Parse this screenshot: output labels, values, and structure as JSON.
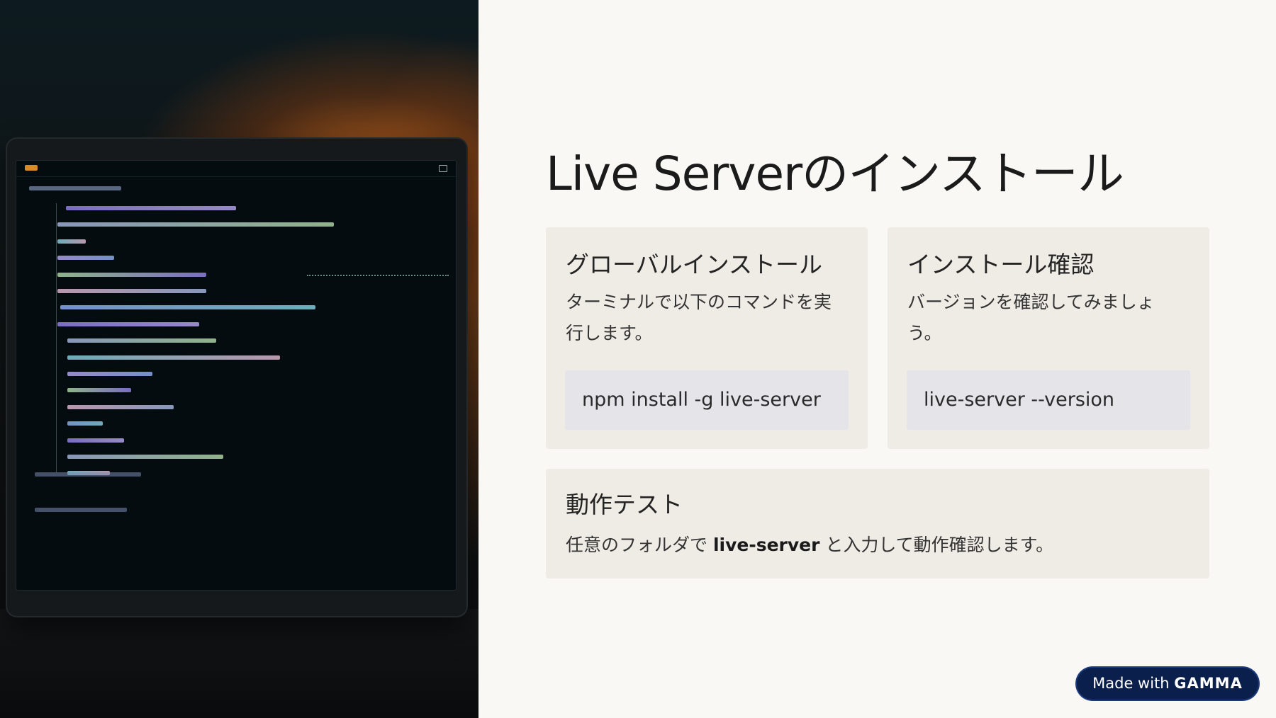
{
  "slide": {
    "title": "Live Serverのインストール"
  },
  "cards": [
    {
      "heading": "グローバルインストール",
      "description": "ターミナルで以下のコマンドを実行します。",
      "command": "npm install -g live-server"
    },
    {
      "heading": "インストール確認",
      "description": "バージョンを確認してみましょう。",
      "command": "live-server --version"
    }
  ],
  "test_card": {
    "heading": "動作テスト",
    "text_before": "任意のフォルダで ",
    "text_bold": "live-server",
    "text_after": " と入力して動作確認します。"
  },
  "badge": {
    "prefix": "Made with ",
    "brand": "GAMMA"
  },
  "image": {
    "icon": "laptop-code-photo-icon"
  },
  "colors": {
    "background": "#f9f8f5",
    "card": "#efece6",
    "code_block": "#e5e4e8",
    "badge": "#0b1f4d"
  }
}
